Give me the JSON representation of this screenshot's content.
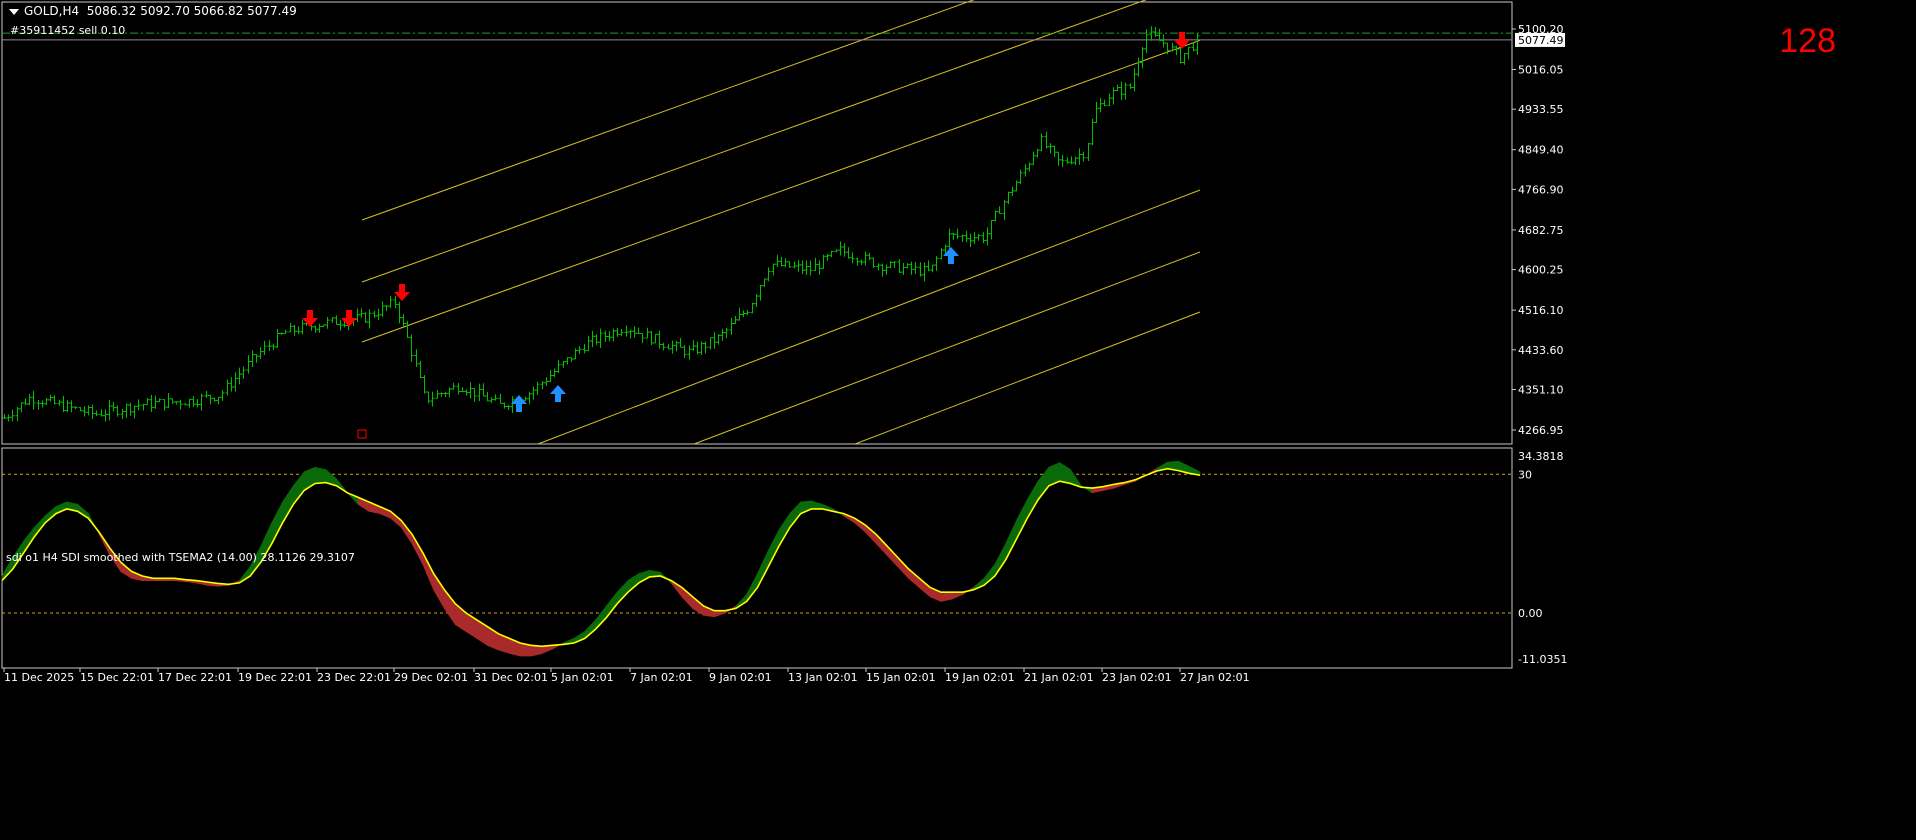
{
  "header": {
    "symbol": "GOLD,H4",
    "ohlc": "5086.32 5092.70 5066.82 5077.49",
    "order_line": "#35911452 sell 0.10",
    "counter": "128"
  },
  "price_axis": {
    "ticks": [
      "5100.20",
      "5016.05",
      "4933.55",
      "4849.40",
      "4766.90",
      "4682.75",
      "4600.25",
      "4516.10",
      "4433.60",
      "4351.10",
      "4266.95"
    ],
    "current_price": "5077.49",
    "current_price_value": 5077.49,
    "order_price_value": 5091.5
  },
  "indicator": {
    "title": "sdi o1 H4 SDI smoothed with TSEMA2 (14.00) 28.1126 29.3107",
    "axis_ticks": [
      "34.3818",
      "30",
      "0.00",
      "-11.0351"
    ],
    "levels": [
      30,
      0
    ],
    "range": [
      -11.0351,
      34.3818
    ],
    "values": [
      7,
      9.5,
      13,
      16.5,
      19.5,
      21.5,
      22.5,
      22,
      20.5,
      17.5,
      14,
      11,
      9,
      8,
      7.5,
      7.5,
      7.5,
      7.2,
      7,
      6.7,
      6.4,
      6.2,
      6.5,
      8,
      11,
      15,
      19.5,
      23.5,
      26.5,
      28,
      28.2,
      27.5,
      26,
      25,
      24,
      23,
      22,
      20,
      17,
      13,
      8.5,
      5,
      2,
      0,
      -1.5,
      -3,
      -4.5,
      -5.5,
      -6.5,
      -7,
      -7.2,
      -7,
      -6.8,
      -6.5,
      -5.5,
      -3.5,
      -1,
      2,
      4.5,
      6.5,
      7.8,
      8,
      7,
      5.5,
      3.5,
      1.5,
      0.5,
      0.5,
      1,
      2.5,
      5.5,
      10,
      14.5,
      18.5,
      21.5,
      22.5,
      22.5,
      22,
      21.5,
      20.5,
      19,
      17,
      14.5,
      12,
      9.5,
      7.5,
      5.5,
      4.5,
      4.5,
      4.5,
      5,
      6,
      8,
      11.5,
      16,
      20.5,
      24.5,
      27.5,
      28.5,
      28,
      27.2,
      27,
      27.3,
      27.8,
      28.2,
      28.8,
      29.8,
      30.7,
      31.2,
      30.8,
      30.2,
      29.8
    ],
    "fast": [
      8,
      12,
      15.5,
      18.5,
      21,
      23,
      24,
      23.5,
      21.5,
      17,
      12.5,
      9,
      7.5,
      7,
      7,
      7,
      7,
      6.8,
      6.5,
      6,
      5.8,
      6,
      7,
      10,
      14.5,
      19.5,
      24,
      27.5,
      30.5,
      31.5,
      31,
      29,
      26,
      23.5,
      22,
      21.5,
      20.5,
      18.5,
      15,
      10.5,
      5,
      1,
      -2.5,
      -4,
      -5.5,
      -7,
      -8,
      -8.7,
      -9.3,
      -9.3,
      -8.8,
      -7.8,
      -6.5,
      -5.5,
      -4,
      -1.5,
      1.5,
      4.5,
      7,
      8.5,
      9.2,
      8.8,
      6.5,
      3.5,
      1,
      -0.5,
      -0.8,
      0,
      1.5,
      4,
      8.5,
      13.5,
      18,
      21.5,
      24,
      24.2,
      23.5,
      22.5,
      21,
      19.5,
      17.5,
      15,
      12.5,
      10,
      7.5,
      5.5,
      3.5,
      2.5,
      3,
      4,
      5.5,
      7.5,
      10.5,
      15,
      20,
      24.5,
      28.5,
      31.5,
      32.5,
      31,
      27.5,
      26,
      26.5,
      27,
      27.8,
      28.5,
      29.7,
      31.3,
      32.6,
      32.8,
      31.7,
      30.5,
      29.5
    ]
  },
  "time_axis": {
    "labels": [
      "11 Dec 2025",
      "15 Dec 22:01",
      "17 Dec 22:01",
      "19 Dec 22:01",
      "23 Dec 22:01",
      "29 Dec 02:01",
      "31 Dec 02:01",
      "5 Jan 02:01",
      "7 Jan 02:01",
      "9 Jan 02:01",
      "13 Jan 02:01",
      "15 Jan 02:01",
      "19 Jan 02:01",
      "21 Jan 02:01",
      "23 Jan 02:01",
      "27 Jan 02:01"
    ]
  },
  "colors": {
    "background": "#000000",
    "candles": "#00c000",
    "channel": "#d8c020",
    "signal_line": "#ffff00",
    "fill_up": "#0a6a0a",
    "fill_down": "#a82a2a",
    "sell_arrow": "#ff0000",
    "buy_arrow": "#1e90ff",
    "axis_text": "#ffffff",
    "grid_border": "#c8c8c8"
  }
}
